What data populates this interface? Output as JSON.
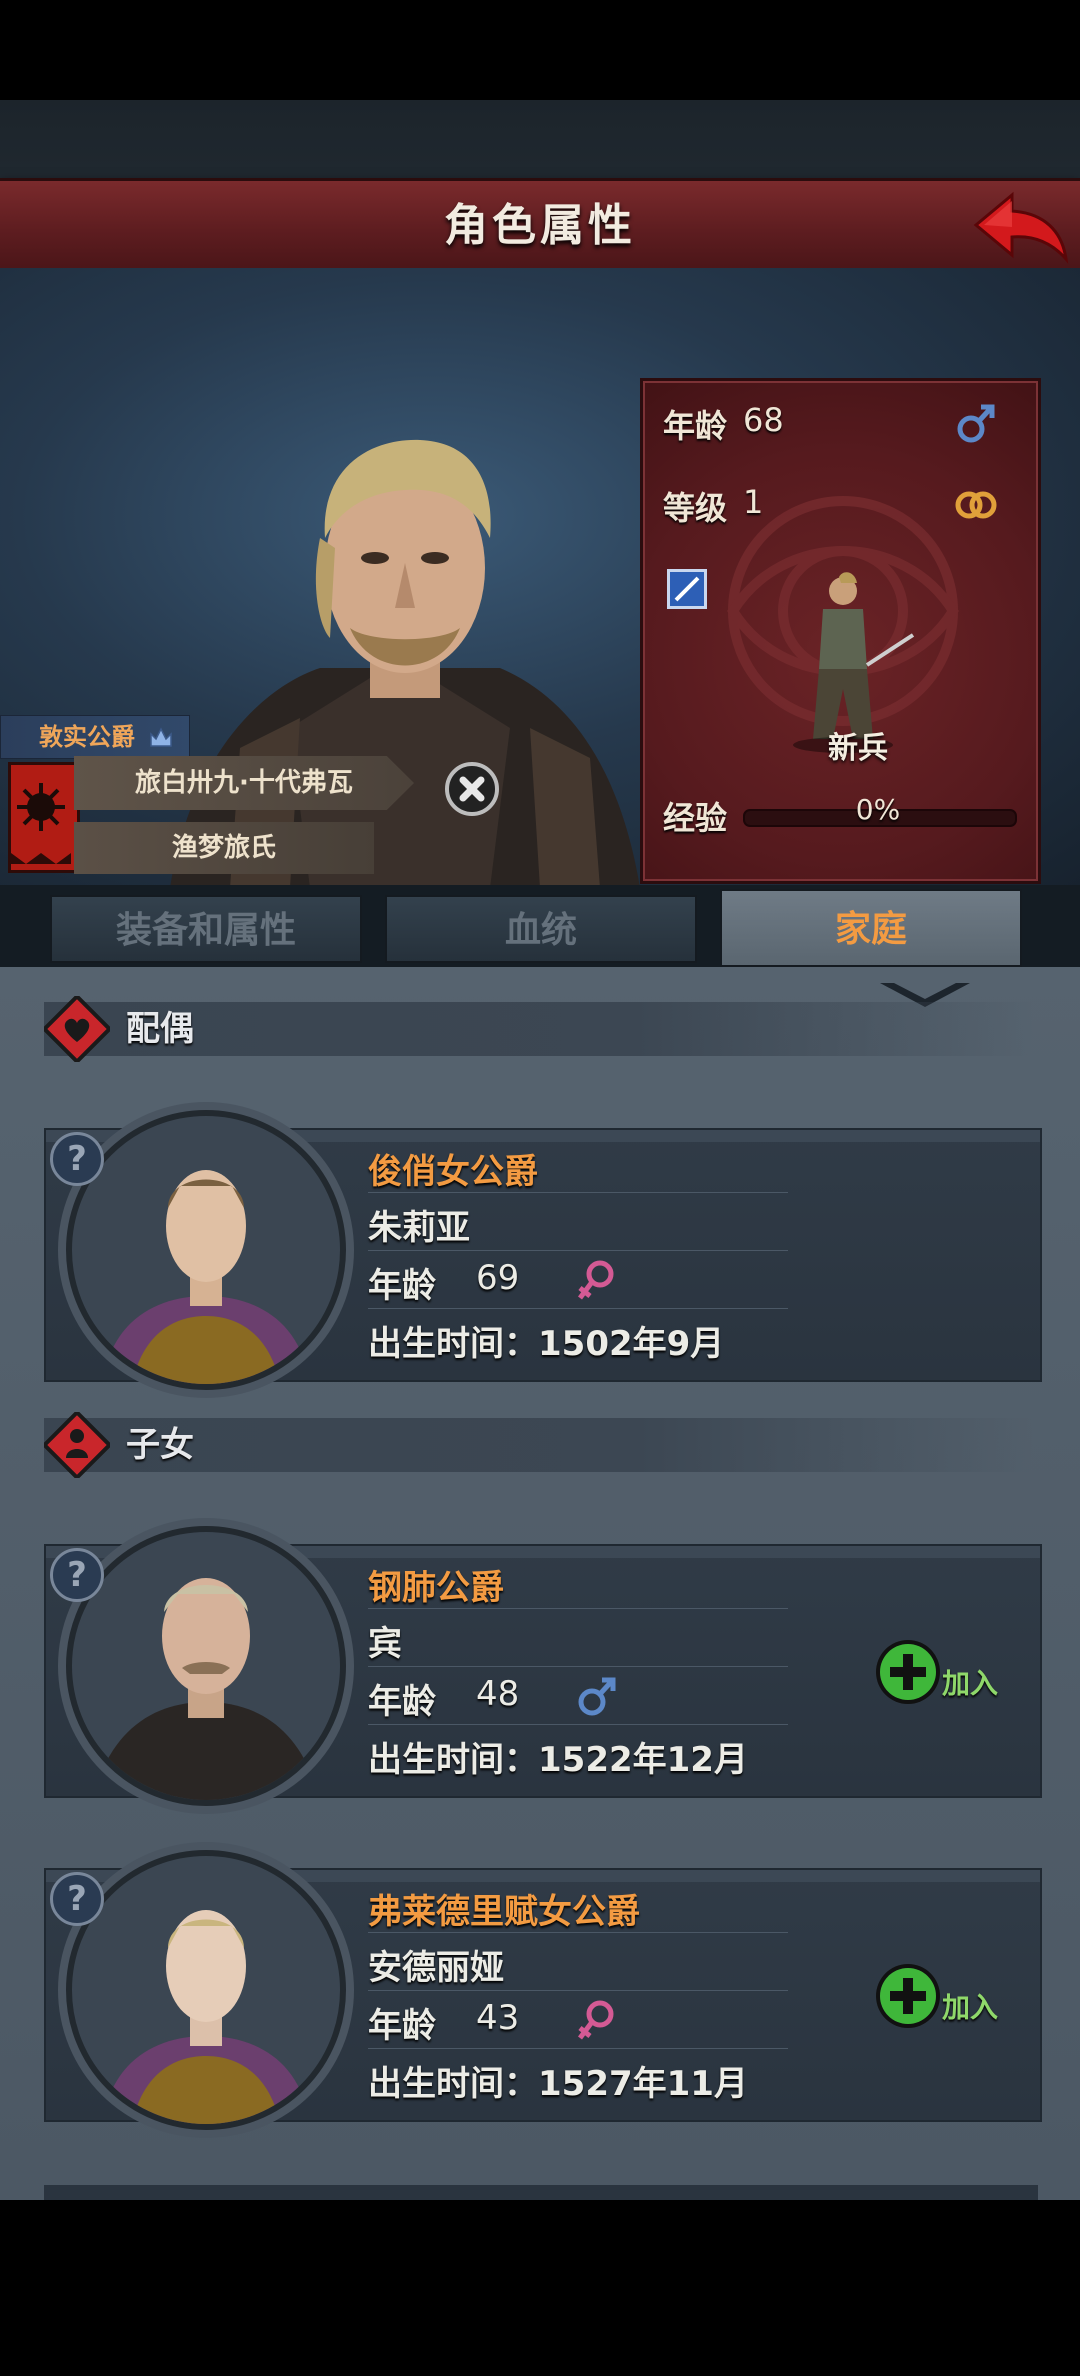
{
  "header": {
    "title": "角色属性"
  },
  "character": {
    "title_tag": "敦实公爵",
    "full_name": "旅白卅九·十代弗瓦",
    "clan": "渔梦旅氏"
  },
  "stats": {
    "age_label": "年龄",
    "age_value": "68",
    "level_label": "等级",
    "level_value": "1",
    "unit_name": "新兵",
    "exp_label": "经验",
    "exp_value": "0%",
    "exp_fraction": 0
  },
  "tabs": [
    {
      "label": "装备和属性"
    },
    {
      "label": "血统"
    },
    {
      "label": "家庭"
    }
  ],
  "sections": {
    "spouse": "配偶",
    "children": "子女"
  },
  "cards": [
    {
      "title": "俊俏女公爵",
      "name": "朱莉亚",
      "age_label": "年龄",
      "age": "69",
      "sex": "female",
      "birth": "出生时间：1502年9月",
      "q": "?"
    },
    {
      "title": "钢肺公爵",
      "name": "宾",
      "age_label": "年龄",
      "age": "48",
      "sex": "male",
      "birth": "出生时间：1522年12月",
      "q": "?",
      "join": "加入"
    },
    {
      "title": "弗莱德里赋女公爵",
      "name": "安德丽娅",
      "age_label": "年龄",
      "age": "43",
      "sex": "female",
      "birth": "出生时间：1527年11月",
      "q": "?",
      "join": "加入"
    }
  ],
  "colors": {
    "accent_orange": "#f39b42",
    "header_red": "#5e1d20",
    "male_blue": "#5c88c8",
    "female_pink": "#d45a94",
    "join_green": "#3fb73a"
  }
}
